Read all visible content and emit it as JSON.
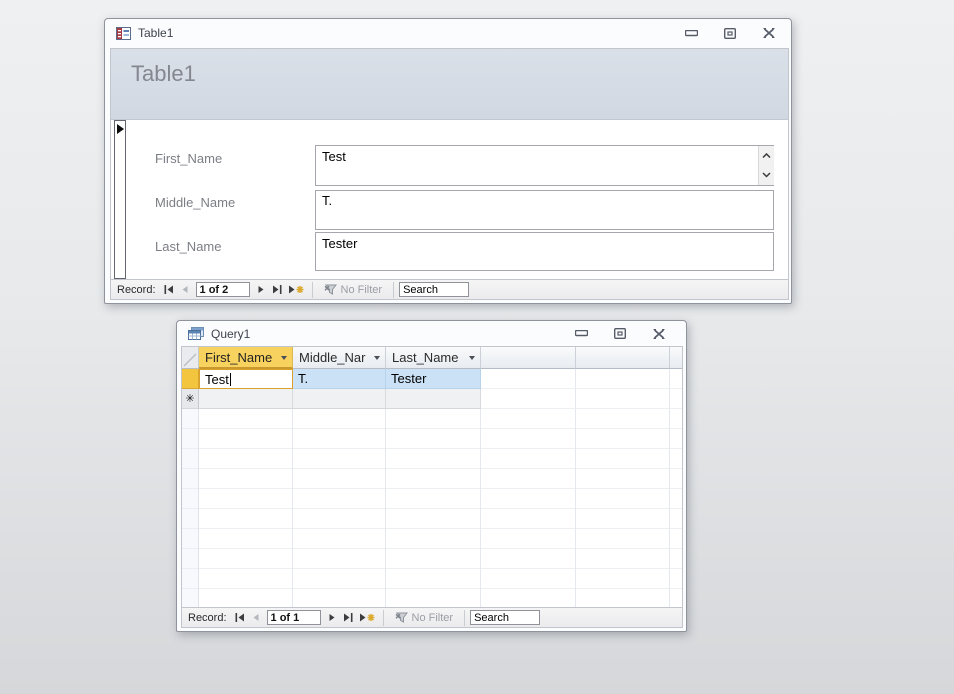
{
  "colors": {
    "active_column_gold": "#f8d25e",
    "current_row_gold": "#f3c53e",
    "selection_blue": "#cbe2f6",
    "form_header_band": "#d6dce4",
    "window_chrome": "#fbfcfd"
  },
  "form_window": {
    "title": "Table1",
    "header_title": "Table1",
    "fields": [
      {
        "label": "First_Name",
        "value": "Test"
      },
      {
        "label": "Middle_Name",
        "value": "T."
      },
      {
        "label": "Last_Name",
        "value": "Tester"
      }
    ],
    "nav": {
      "record_label": "Record:",
      "position": "1 of 2",
      "no_filter_label": "No Filter",
      "search_value": "Search"
    }
  },
  "query_window": {
    "title": "Query1",
    "columns": [
      {
        "label": "First_Name"
      },
      {
        "label": "Middle_Nar"
      },
      {
        "label": "Last_Name"
      }
    ],
    "rows": [
      {
        "cells": [
          "Test",
          "T.",
          "Tester"
        ]
      }
    ],
    "new_record_glyph": "✳",
    "nav": {
      "record_label": "Record:",
      "position": "1 of 1",
      "no_filter_label": "No Filter",
      "search_value": "Search"
    }
  }
}
